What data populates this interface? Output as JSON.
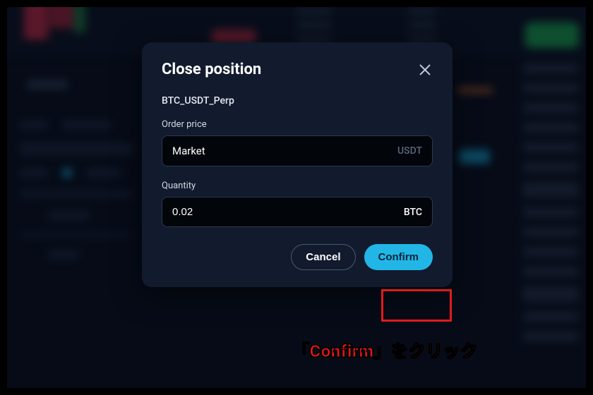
{
  "modal": {
    "title": "Close position",
    "symbol": "BTC_USDT_Perp",
    "order_price_label": "Order price",
    "order_price_value": "Market",
    "order_price_unit": "USDT",
    "quantity_label": "Quantity",
    "quantity_value": "0.02",
    "quantity_unit": "BTC",
    "cancel_label": "Cancel",
    "confirm_label": "Confirm"
  },
  "annotation": {
    "text": "「Confirm」をクリック"
  },
  "colors": {
    "accent": "#22b6e6",
    "danger": "#e11b1b",
    "modal_bg": "#121b2e",
    "page_bg": "#0a1020"
  }
}
